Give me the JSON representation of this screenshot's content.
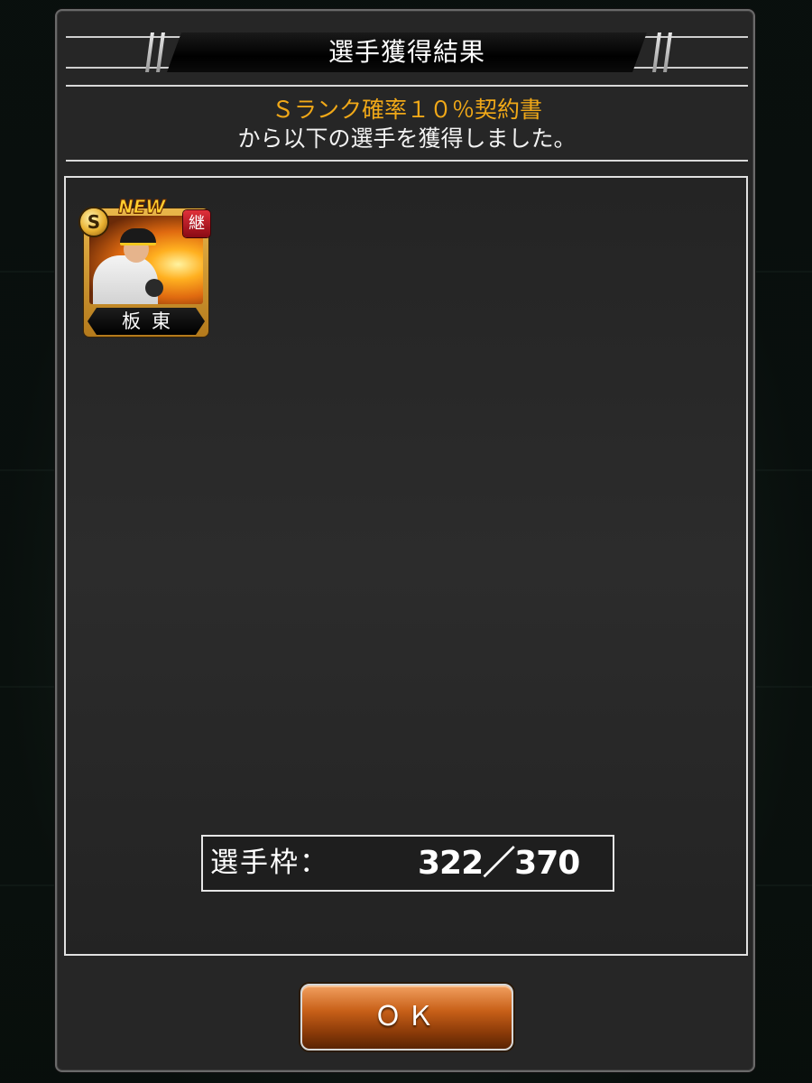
{
  "dialog": {
    "title": "選手獲得結果",
    "contract_name": "Ｓランク確率１０％契約書",
    "message": "から以下の選手を獲得しました。"
  },
  "acquired_players": [
    {
      "name": "板東",
      "rank": "S",
      "new_badge": "NEW",
      "succession_badge": "継",
      "frame_color": "#d9a03a"
    }
  ],
  "slot_counter": {
    "label": "選手枠：",
    "value": "322／370"
  },
  "actions": {
    "ok_label": "ＯＫ"
  },
  "colors": {
    "contract_text": "#f0a818",
    "button_gradient_top": "#f2a060",
    "button_gradient_bottom": "#5a2404",
    "panel_bg": "#262626"
  },
  "icons": {
    "rank_badge": "rank-s-coin-icon",
    "succession_badge": "succession-kanji-icon",
    "new_badge": "new-label-icon"
  }
}
